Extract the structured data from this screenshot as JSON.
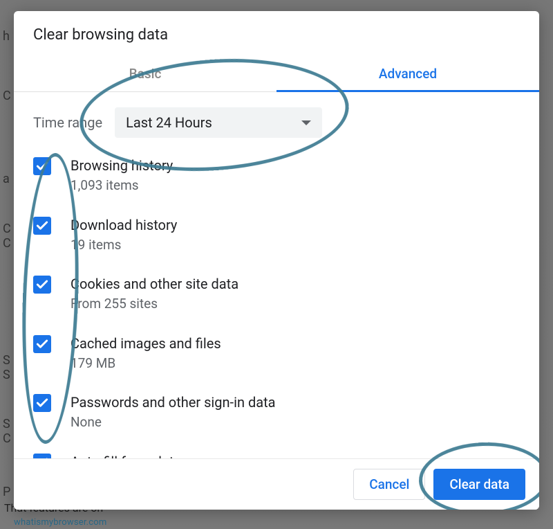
{
  "background": {
    "feature_text": "That features are on"
  },
  "watermark": "whatismybrowser.com",
  "dialog": {
    "title": "Clear browsing data",
    "tabs": {
      "basic": "Basic",
      "advanced": "Advanced",
      "active": "advanced"
    },
    "time_range": {
      "label": "Time range",
      "value": "Last 24 Hours"
    },
    "options": [
      {
        "label": "Browsing history",
        "sub": "1,093 items",
        "checked": true
      },
      {
        "label": "Download history",
        "sub": "19 items",
        "checked": true
      },
      {
        "label": "Cookies and other site data",
        "sub": "From 255 sites",
        "checked": true
      },
      {
        "label": "Cached images and files",
        "sub": "179 MB",
        "checked": true
      },
      {
        "label": "Passwords and other sign-in data",
        "sub": "None",
        "checked": true
      },
      {
        "label": "Auto-fill form data",
        "sub": "",
        "checked": true
      }
    ],
    "footer": {
      "cancel": "Cancel",
      "clear": "Clear data"
    }
  }
}
